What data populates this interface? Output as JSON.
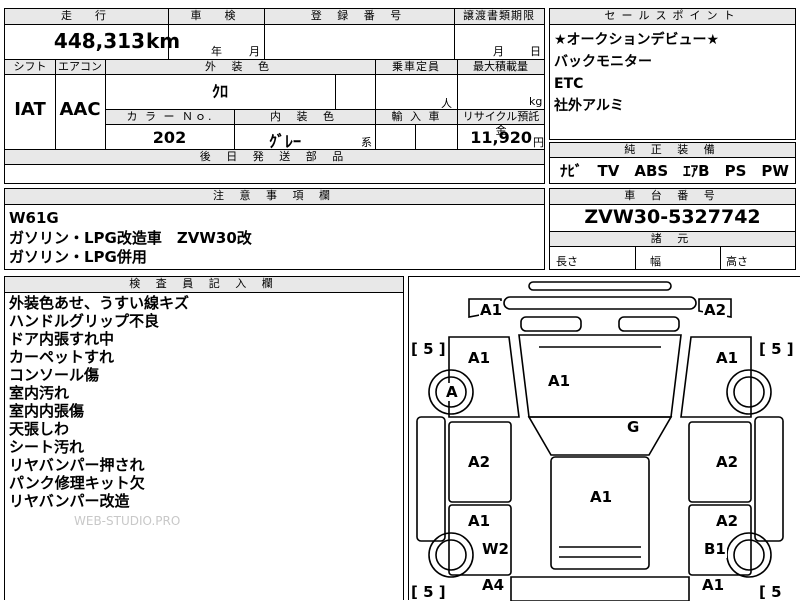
{
  "top_row": {
    "mileage_label": "走　行",
    "mileage_value": "448,313",
    "mileage_unit": "km",
    "inspection_label": "車　検",
    "inspection_year": "年",
    "inspection_month": "月",
    "registration_label": "登 録 番 号",
    "transfer_label": "譲渡書類期限",
    "transfer_month": "月",
    "transfer_day": "日"
  },
  "mid_row": {
    "shift_label": "シフト",
    "aircon_label": "エアコン",
    "exterior_color_label": "外 装 色",
    "exterior_color_value": "ｸﾛ",
    "capacity_label": "乗車定員",
    "capacity_unit": "人",
    "max_load_label": "最大積載量",
    "max_load_unit": "kg",
    "shift_value": "IAT",
    "aircon_value": "AAC",
    "color_no_label": "カ ラ ー Ｎｏ.",
    "color_no_value": "202",
    "interior_color_label": "内 装 色",
    "interior_color_value": "ｸﾞﾚｰ",
    "interior_color_suffix": "系",
    "import_label": "輸 入 車",
    "recycle_label": "リサイクル預託金",
    "recycle_value": "11,920",
    "recycle_unit": "円",
    "later_parts_label": "後 日 発 送 部 品"
  },
  "sales_points": {
    "label": "セールスポイント",
    "lines": [
      "★オークションデビュー★",
      "バックモニター",
      "ETC",
      "社外アルミ"
    ]
  },
  "equipment": {
    "label": "純 正 装 備",
    "value": "ﾅﾋﾞ　TV　ABS　ｴｱB　PS　PW"
  },
  "notes": {
    "label": "注 意 事 項 欄",
    "lines": [
      "W61G",
      "ガソリン・LPG改造車　ZVW30改",
      "ガソリン・LPG併用"
    ]
  },
  "chassis": {
    "label": "車 台 番 号",
    "value": "ZVW30-5327742"
  },
  "dimensions": {
    "label": "諸 元",
    "length_label": "長さ",
    "width_label": "幅",
    "height_label": "高さ"
  },
  "inspector": {
    "label": "検 査 員 記 入 欄",
    "lines": [
      "外装色あせ、うすい線キズ",
      "ハンドルグリップ不良",
      "ドア内張すれ中",
      "カーペットすれ",
      "コンソール傷",
      "室内汚れ",
      "室内内張傷",
      "天張しわ",
      "シート汚れ",
      "リヤバンパー押され",
      "パンク修理キット欠",
      "リヤバンパー改造"
    ],
    "watermark": "WEB-STUDIO.PRO"
  },
  "diagram": {
    "marks": {
      "front_left": "A1",
      "front_right": "A2",
      "fender_left": "A1",
      "fender_right": "A1",
      "hood": "A1",
      "wheel_front_left": "A",
      "windshield": "G",
      "door_front_left": "A2",
      "door_front_right": "A2",
      "roof": "A1",
      "door_rear_left": "A1",
      "door_rear_right": "A2",
      "wheel_rear_left": "W2",
      "wheel_rear_right": "B1",
      "rear_left": "A4",
      "rear_right": "A1"
    },
    "tire_brackets": {
      "front_left": "[ 5 ]",
      "front_right": "[ 5 ]",
      "rear_left": "[ 5 ]",
      "rear_right": "[ 5"
    }
  }
}
